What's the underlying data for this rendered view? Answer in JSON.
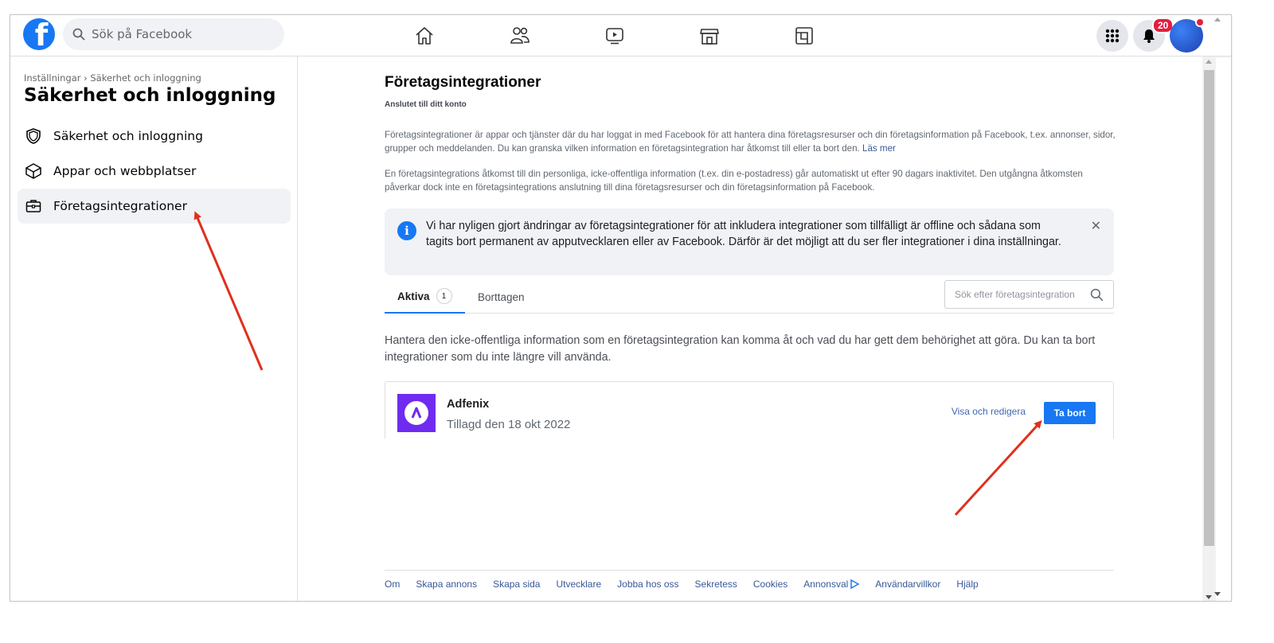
{
  "topbar": {
    "search_placeholder": "Sök på Facebook",
    "notification_count": "20",
    "icons": [
      "facebook-logo",
      "search-icon",
      "home-icon",
      "friends-icon",
      "watch-icon",
      "marketplace-icon",
      "gaming-icon",
      "menu-grid-icon",
      "bell-icon",
      "avatar"
    ]
  },
  "sidebar": {
    "breadcrumb": "Inställningar › Säkerhet och inloggning",
    "title": "Säkerhet och inloggning",
    "items": [
      {
        "label": "Säkerhet och inloggning",
        "icon": "shield-icon",
        "active": false
      },
      {
        "label": "Appar och webbplatser",
        "icon": "cube-icon",
        "active": false
      },
      {
        "label": "Företagsintegrationer",
        "icon": "briefcase-icon",
        "active": true
      }
    ]
  },
  "main": {
    "title": "Företagsintegrationer",
    "subtitle": "Anslutet till ditt konto",
    "para1": "Företagsintegrationer är appar och tjänster där du har loggat in med Facebook för att hantera dina företagsresurser och din företagsinformation på Facebook, t.ex. annonser, sidor, grupper och meddelanden. Du kan granska vilken information en företagsintegration har åtkomst till eller ta bort den.",
    "para1_link": "Läs mer",
    "para2": "En företagsintegrations åtkomst till din personliga, icke-offentliga information (t.ex. din e-postadress) går automatiskt ut efter 90 dagars inaktivitet. Den utgångna åtkomsten påverkar dock inte en företagsintegrations anslutning till dina företagsresurser och din företagsinformation på Facebook.",
    "info_banner": "Vi har nyligen gjort ändringar av företagsintegrationer för att inkludera integrationer som tillfälligt är offline och sådana som tagits bort permanent av apputvecklaren eller av Facebook. Därför är det möjligt att du ser fler integrationer i dina inställningar.",
    "tabs": [
      {
        "label": "Aktiva",
        "count": "1",
        "active": true
      },
      {
        "label": "Borttagen",
        "active": false
      }
    ],
    "search_placeholder": "Sök efter företagsintegration",
    "manage_text": "Hantera den icke-offentliga information som en företagsintegration kan komma åt och vad du har gett dem behörighet att göra. Du kan ta bort integrationer som du inte längre vill använda.",
    "integration": {
      "name": "Adfenix",
      "added": "Tillagd den 18 okt 2022",
      "edit_label": "Visa och redigera",
      "remove_label": "Ta bort",
      "icon_color": "#6f2bf0"
    },
    "footer_links": [
      "Om",
      "Skapa annons",
      "Skapa sida",
      "Utvecklare",
      "Jobba hos oss",
      "Sekretess",
      "Cookies",
      "Annonsval",
      "Användarvillkor",
      "Hjälp"
    ]
  },
  "colors": {
    "brand": "#1877f2",
    "annotation_arrow": "#e0301e"
  }
}
